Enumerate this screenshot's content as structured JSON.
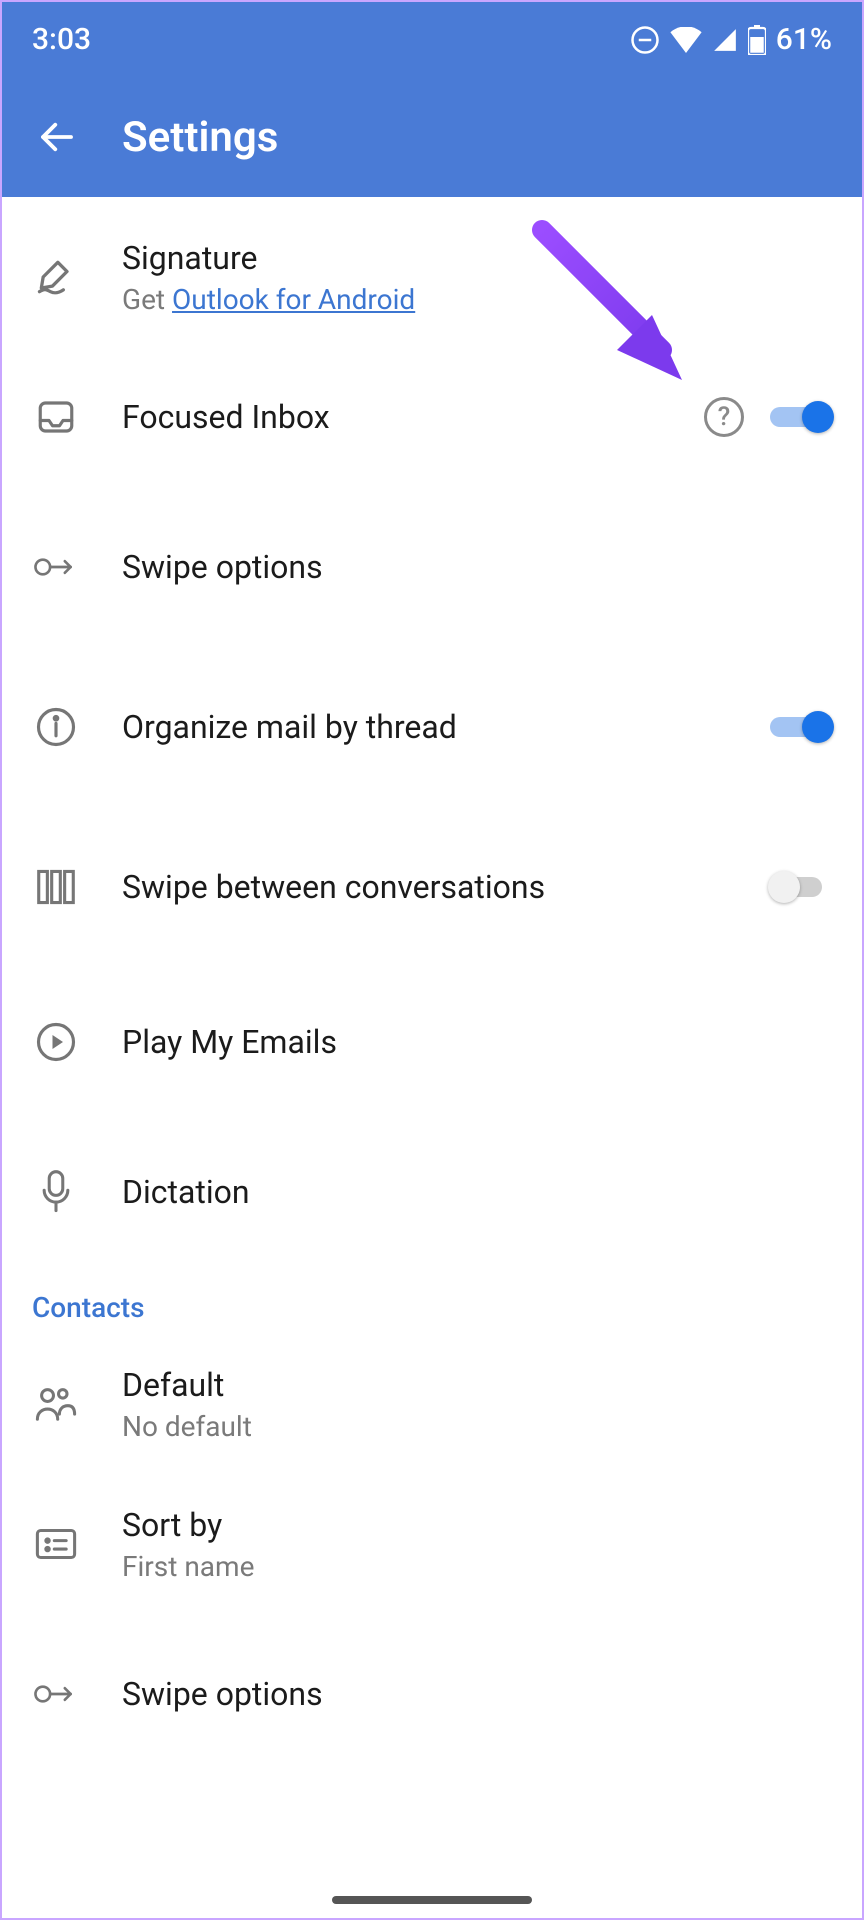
{
  "status": {
    "time": "3:03",
    "battery": "61%"
  },
  "header": {
    "title": "Settings"
  },
  "mail": {
    "signature": {
      "title": "Signature",
      "sub_prefix": "Get ",
      "sub_link": "Outlook for Android"
    },
    "focused": {
      "title": "Focused Inbox",
      "on": true
    },
    "swipe": {
      "title": "Swipe options"
    },
    "thread": {
      "title": "Organize mail by thread",
      "on": true
    },
    "swipe_conv": {
      "title": "Swipe between conversations",
      "on": false
    },
    "play": {
      "title": "Play My Emails"
    },
    "dictation": {
      "title": "Dictation"
    }
  },
  "sections": {
    "contacts": "Contacts"
  },
  "contacts": {
    "default": {
      "title": "Default",
      "sub": "No default"
    },
    "sort": {
      "title": "Sort by",
      "sub": "First name"
    },
    "swipe": {
      "title": "Swipe options"
    }
  }
}
